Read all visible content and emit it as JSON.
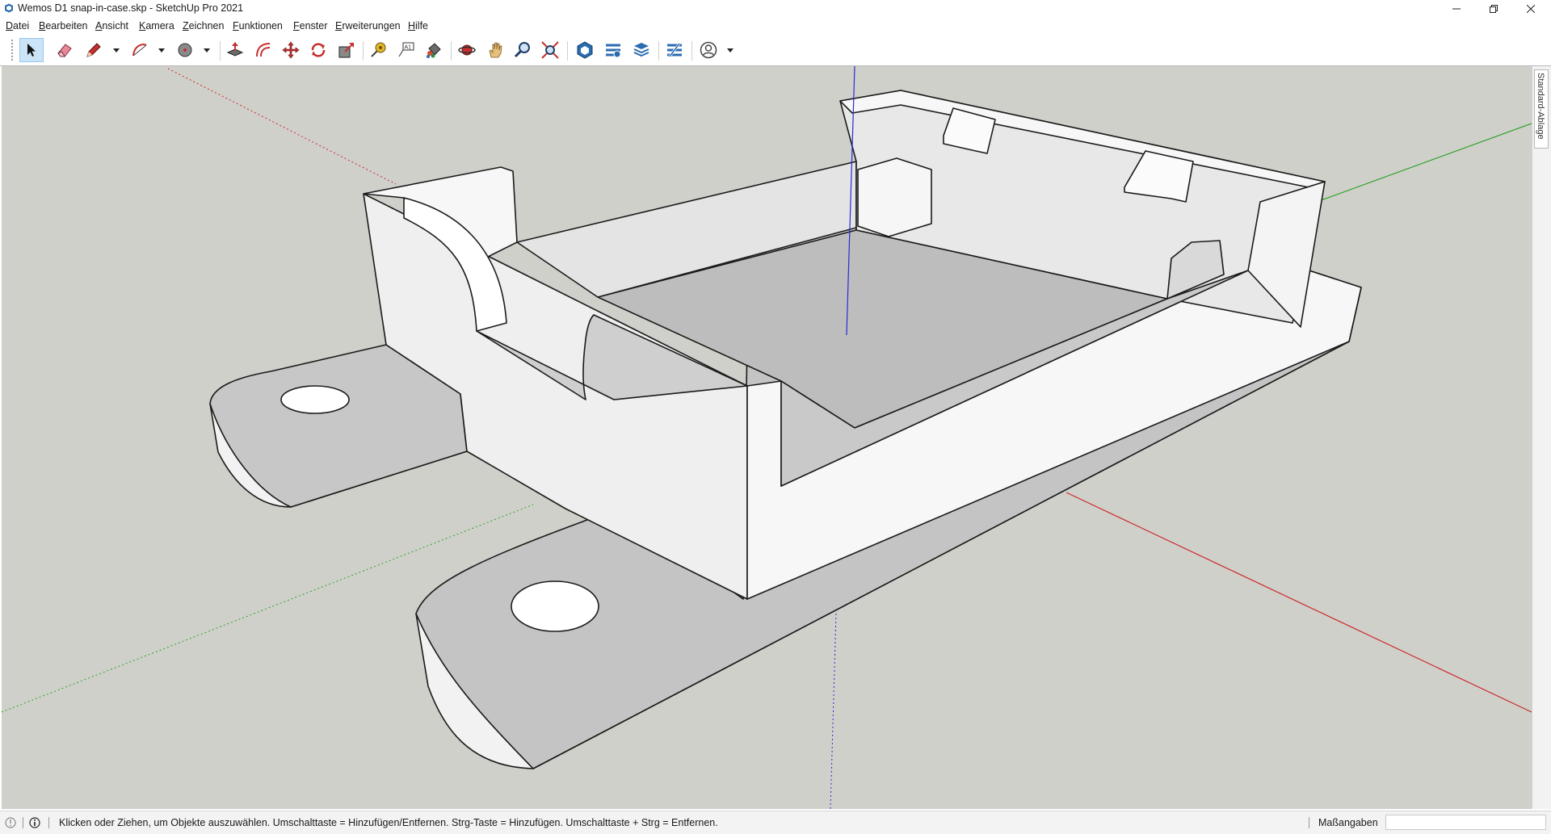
{
  "window": {
    "title": "Wemos D1 snap-in-case.skp - SketchUp Pro 2021",
    "minimize_label": "–",
    "restore_label": "❐",
    "close_label": "✕"
  },
  "menu": {
    "items": [
      {
        "label": "Datei"
      },
      {
        "label": "Bearbeiten"
      },
      {
        "label": "Ansicht"
      },
      {
        "label": "Kamera"
      },
      {
        "label": "Zeichnen"
      },
      {
        "label": "Funktionen"
      },
      {
        "label": "Fenster"
      },
      {
        "label": "Erweiterungen"
      },
      {
        "label": "Hilfe"
      }
    ]
  },
  "toolbar": {
    "tools": [
      {
        "name": "select-tool",
        "icon": "arrow-cursor-icon",
        "active": true
      },
      {
        "name": "eraser-tool",
        "icon": "eraser-icon"
      },
      {
        "name": "line-tool",
        "icon": "pencil-icon"
      },
      {
        "name": "arc-tool",
        "icon": "arc-icon"
      },
      {
        "name": "shape-tool",
        "icon": "circle-icon"
      },
      {
        "name": "push-pull-tool",
        "icon": "push-pull-icon"
      },
      {
        "name": "offset-tool",
        "icon": "offset-icon"
      },
      {
        "name": "move-tool",
        "icon": "move-icon"
      },
      {
        "name": "rotate-tool",
        "icon": "rotate-icon"
      },
      {
        "name": "scale-tool",
        "icon": "scale-icon"
      },
      {
        "name": "tape-measure-tool",
        "icon": "tape-measure-icon"
      },
      {
        "name": "text-tool",
        "icon": "text-icon"
      },
      {
        "name": "paint-bucket-tool",
        "icon": "paint-bucket-icon"
      },
      {
        "name": "orbit-tool",
        "icon": "orbit-icon"
      },
      {
        "name": "pan-tool",
        "icon": "hand-icon"
      },
      {
        "name": "zoom-tool",
        "icon": "magnifier-icon"
      },
      {
        "name": "zoom-extents-tool",
        "icon": "zoom-extents-icon"
      },
      {
        "name": "3d-warehouse-button",
        "icon": "warehouse-icon"
      },
      {
        "name": "extension-warehouse-button",
        "icon": "extension-warehouse-icon"
      },
      {
        "name": "layout-button",
        "icon": "layout-icon"
      },
      {
        "name": "extension-manager-button",
        "icon": "extension-manager-icon"
      },
      {
        "name": "account-button",
        "icon": "user-icon"
      }
    ]
  },
  "tray": {
    "label": "Standard-Ablage"
  },
  "status": {
    "text": "Klicken oder Ziehen, um Objekte auszuwählen. Umschalttaste = Hinzufügen/Entfernen. Strg-Taste = Hinzufügen. Umschalttaste + Strg = Entfernen.",
    "measurements_label": "Maßangaben",
    "measurements_value": ""
  },
  "colors": {
    "viewport_bg": "#d0d0ca",
    "model_face_light": "#f7f7f7",
    "model_face_shadow": "#bdbdbd",
    "axis_red": "#cc2a2a",
    "axis_green": "#2fa32f",
    "axis_blue": "#2a2ad6",
    "active_tool_bg": "#cce4f7"
  }
}
